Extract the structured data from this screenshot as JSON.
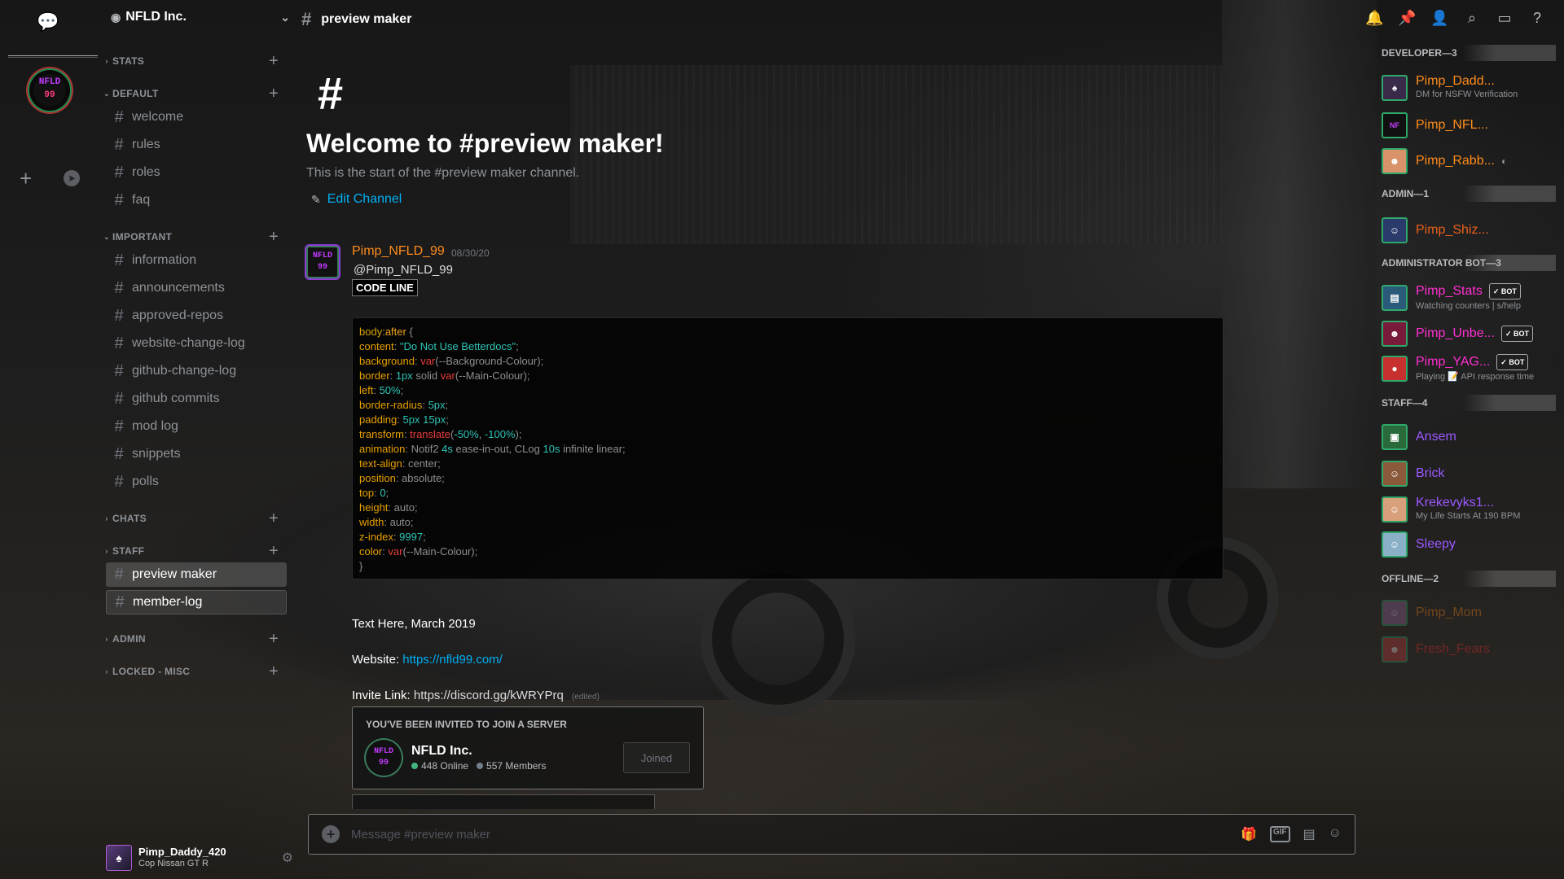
{
  "server": {
    "name": "NFLD Inc.",
    "icon_text_top": "NFLD",
    "icon_text_bottom": "99"
  },
  "guild_bar": {
    "home_icon": "chat-bubble-icon",
    "add_icon": "plus-icon",
    "discover_icon": "compass-icon"
  },
  "categories": [
    {
      "label": "STATS"
    },
    {
      "label": "DEFAULT"
    },
    {
      "label": "IMPORTANT"
    },
    {
      "label": "CHATS"
    },
    {
      "label": "STAFF"
    },
    {
      "label": "ADMIN"
    },
    {
      "label": "LOCKED - MISC"
    }
  ],
  "channels": {
    "default": [
      "welcome",
      "rules",
      "roles",
      "faq"
    ],
    "important": [
      "information",
      "announcements",
      "approved-repos",
      "website-change-log",
      "github-change-log",
      "github commits",
      "mod log",
      "snippets",
      "polls"
    ],
    "staff": [
      "preview maker",
      "member-log"
    ]
  },
  "user_panel": {
    "name": "Pimp_Daddy_420",
    "status": "Cop Nissan GT R"
  },
  "header": {
    "channel": "preview maker"
  },
  "welcome": {
    "hash": "#",
    "title": "Welcome to #preview maker!",
    "subtitle": "This is the start of the #preview maker channel.",
    "edit": "Edit Channel"
  },
  "message": {
    "author": "Pimp_NFLD_99",
    "time": "08/30/20",
    "handle": "@Pimp_NFLD_99",
    "code_label": "CODE LINE",
    "avatar_top": "NFLD",
    "avatar_bottom": "99",
    "text_line": "Text Here, March 2019",
    "website_label": "Website:",
    "website_url": "https://nfld99.com/",
    "invite_label": "Invite Link:",
    "invite_url": "https://discord.gg/kWRYPrq",
    "edited": "(edited)"
  },
  "code_lines": [
    [
      [
        "k-sel",
        "body"
      ],
      [
        "k-pseudo",
        ":after"
      ],
      [
        "k-plain",
        " {"
      ]
    ],
    [
      [
        "k-prop",
        "content"
      ],
      [
        "k-plain",
        ": "
      ],
      [
        "k-str",
        "\"Do Not Use Betterdocs\""
      ],
      [
        "k-plain",
        ";"
      ]
    ],
    [
      [
        "k-prop",
        "background"
      ],
      [
        "k-plain",
        ": "
      ],
      [
        "k-fn",
        "var"
      ],
      [
        "k-plain",
        "(--Background-Colour);"
      ]
    ],
    [
      [
        "k-prop",
        "border"
      ],
      [
        "k-plain",
        ": "
      ],
      [
        "k-num",
        "1px"
      ],
      [
        "k-plain",
        " solid "
      ],
      [
        "k-fn",
        "var"
      ],
      [
        "k-plain",
        "(--Main-Colour);"
      ]
    ],
    [
      [
        "k-prop",
        "left"
      ],
      [
        "k-plain",
        ": "
      ],
      [
        "k-num",
        "50%"
      ],
      [
        "k-plain",
        ";"
      ]
    ],
    [
      [
        "k-prop",
        "border-radius"
      ],
      [
        "k-plain",
        ": "
      ],
      [
        "k-num",
        "5px"
      ],
      [
        "k-plain",
        ";"
      ]
    ],
    [
      [
        "k-prop",
        "padding"
      ],
      [
        "k-plain",
        ": "
      ],
      [
        "k-num",
        "5px 15px"
      ],
      [
        "k-plain",
        ";"
      ]
    ],
    [
      [
        "k-prop",
        "transform"
      ],
      [
        "k-plain",
        ": "
      ],
      [
        "k-fn",
        "translate"
      ],
      [
        "k-plain",
        "("
      ],
      [
        "k-num",
        "-50%"
      ],
      [
        "k-plain",
        ", "
      ],
      [
        "k-num",
        "-100%"
      ],
      [
        "k-plain",
        ");"
      ]
    ],
    [
      [
        "k-prop",
        "animation"
      ],
      [
        "k-plain",
        ": Notif2 "
      ],
      [
        "k-num",
        "4s"
      ],
      [
        "k-plain",
        " ease-in-out, CLog "
      ],
      [
        "k-num",
        "10s"
      ],
      [
        "k-plain",
        " infinite linear;"
      ]
    ],
    [
      [
        "k-prop",
        "text-align"
      ],
      [
        "k-plain",
        ": center;"
      ]
    ],
    [
      [
        "k-prop",
        "position"
      ],
      [
        "k-plain",
        ": absolute;"
      ]
    ],
    [
      [
        "k-prop",
        "top"
      ],
      [
        "k-plain",
        ": "
      ],
      [
        "k-num",
        "0"
      ],
      [
        "k-plain",
        ";"
      ]
    ],
    [
      [
        "k-prop",
        "height"
      ],
      [
        "k-plain",
        ": auto;"
      ]
    ],
    [
      [
        "k-prop",
        "width"
      ],
      [
        "k-plain",
        ": auto;"
      ]
    ],
    [
      [
        "k-prop",
        "z-index"
      ],
      [
        "k-plain",
        ": "
      ],
      [
        "k-num",
        "9997"
      ],
      [
        "k-plain",
        ";"
      ]
    ],
    [
      [
        "k-prop",
        "color"
      ],
      [
        "k-plain",
        ": "
      ],
      [
        "k-fn",
        "var"
      ],
      [
        "k-plain",
        "(--Main-Colour);"
      ]
    ],
    [
      [
        "k-plain",
        "}"
      ]
    ]
  ],
  "invite": {
    "heading": "YOU'VE BEEN INVITED TO JOIN A SERVER",
    "name": "NFLD Inc.",
    "online": "448 Online",
    "members": "557 Members",
    "button": "Joined"
  },
  "composer": {
    "placeholder": "Message #preview maker"
  },
  "member_groups": [
    {
      "label": "DEVELOPER—3"
    },
    {
      "label": "ADMIN—1"
    },
    {
      "label": "ADMINISTRATOR BOT—3"
    },
    {
      "label": "STAFF—4"
    },
    {
      "label": "OFFLINE—2"
    }
  ],
  "members": [
    {
      "name": "Pimp_Dadd...",
      "sub": "DM for NSFW Verification",
      "color": "#ff8c1a"
    },
    {
      "name": "Pimp_NFL...",
      "sub": "",
      "color": "#ff8c1a"
    },
    {
      "name": "Pimp_Rabb...",
      "sub": "",
      "color": "#ff8c1a"
    },
    {
      "name": "Pimp_Shiz...",
      "sub": "",
      "color": "#e8601a"
    },
    {
      "name": "Pimp_Stats",
      "sub": "Watching counters | s/help",
      "color": "#ff2fd0",
      "bot": "✓ BOT"
    },
    {
      "name": "Pimp_Unbe...",
      "sub": "",
      "color": "#ff2fd0",
      "bot": "✓ BOT"
    },
    {
      "name": "Pimp_YAG...",
      "sub": "Playing 📝 API response time",
      "color": "#ff2fd0",
      "bot": "✓ BOT"
    },
    {
      "name": "Ansem",
      "sub": "",
      "color": "#9b59ff"
    },
    {
      "name": "Brick",
      "sub": "",
      "color": "#9b59ff"
    },
    {
      "name": "Krekevyks1...",
      "sub": "My Life Starts At 190 BPM",
      "color": "#9b59ff"
    },
    {
      "name": "Sleepy",
      "sub": "",
      "color": "#9b59ff"
    },
    {
      "name": "Pimp_Mom",
      "sub": "",
      "color": "#ff8c1a"
    },
    {
      "name": "Fresh_Fears",
      "sub": "",
      "color": "#ff2f2f"
    }
  ],
  "header_icons": [
    "bell-icon",
    "pin-icon",
    "members-icon",
    "search-icon",
    "inbox-icon",
    "help-icon"
  ]
}
